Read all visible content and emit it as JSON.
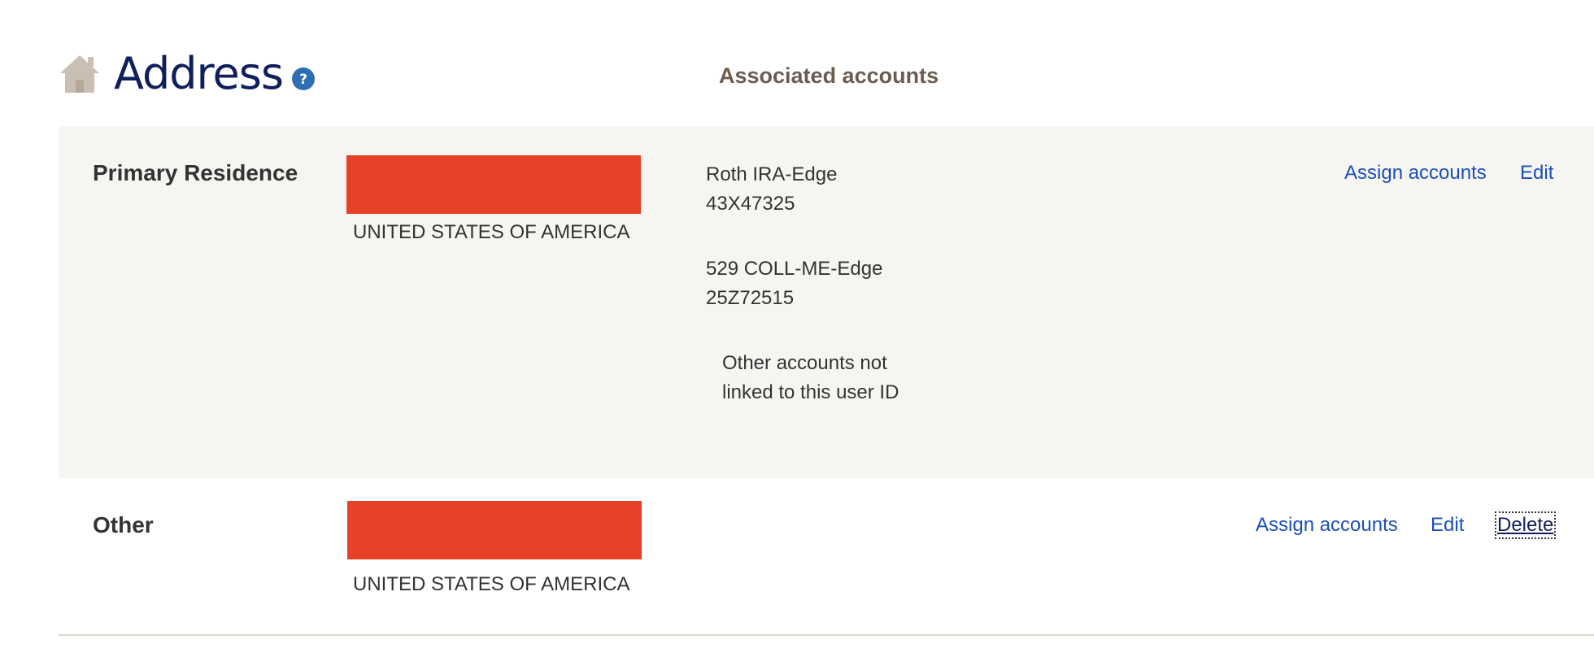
{
  "header": {
    "title": "Address",
    "home_icon": "home-icon",
    "help_icon": "help-icon",
    "associated_accounts_label": "Associated accounts"
  },
  "colors": {
    "title": "#0f1f5c",
    "link": "#1a4fb8",
    "redaction": "#e94127",
    "row_background": "#f6f5f2",
    "section_header": "#6b5d4f"
  },
  "addresses": [
    {
      "type_label": "Primary Residence",
      "country": "UNITED STATES OF AMERICA",
      "accounts": [
        {
          "name": "Roth IRA-Edge",
          "number": "43X47325"
        },
        {
          "name": "529 COLL-ME-Edge",
          "number": "25Z72515"
        }
      ],
      "other_accounts_note_line1": "Other accounts not",
      "other_accounts_note_line2": "linked to this user ID",
      "actions": {
        "assign": "Assign accounts",
        "edit": "Edit"
      }
    },
    {
      "type_label": "Other",
      "country": "UNITED STATES OF AMERICA",
      "actions": {
        "assign": "Assign accounts",
        "edit": "Edit",
        "delete": "Delete"
      }
    }
  ]
}
